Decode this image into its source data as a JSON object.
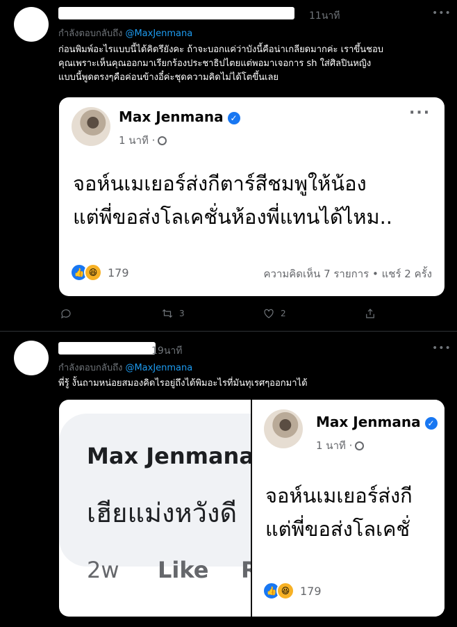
{
  "tweet1": {
    "time": "11นาที",
    "replying_prefix": "กำลังตอบกลับถึง",
    "replying_handle": "@MaxJenmana",
    "text_lines": [
      "ก่อนพิมพ์อะไรแบบนี้ได้คิดรึยังคะ ถ้าจะบอกแค่ว่าบังนี้คือน่าเกลียดมากค่ะ เราขึ้นชอบ",
      "คุณเพราะเห็นคุณออกมาเรียกร้องประชาธิปไตยแต่พอมาเจอการ sh ใส่ศิลปินหญิง",
      "แบบนี้พูดตรงๆคือค่อนข้างอี๋ค่ะชุดความคิดไม่ได้โตขึ้นเลย"
    ],
    "card": {
      "name": "Max Jenmana",
      "time": "1 นาที ·",
      "post_lines": [
        "จอห์นเมเยอร์ส่งกีตาร์สีชมพูให้น้อง",
        "แต่พี่ขอส่งโลเคชั่นห้องพี่แทนได้ไหม.."
      ],
      "reaction_count": "179",
      "stats": "ความคิดเห็น 7 รายการ • แชร์ 2 ครั้ง"
    },
    "actions": {
      "reply_count": "",
      "retweet_count": "3",
      "like_count": "2"
    }
  },
  "tweet2": {
    "time": "19นาที",
    "replying_prefix": "กำลังตอบกลับถึง",
    "replying_handle": "@MaxJenmana",
    "text": "พี่รู้ งั้นถามหน่อยสมองคิดไรอยู่ถึงได้พิมอะไรที่มันทุเรศๆออกมาได้",
    "left_panel": {
      "name": "Max Jenmana",
      "post": "เฮียแม่งหวังดี",
      "meta_time": "2w",
      "meta_like": "Like",
      "meta_reply": "R"
    },
    "right_panel": {
      "name": "Max Jenmana",
      "time": "1 นาที ·",
      "post_lines": [
        "จอห์นเมเยอร์ส่งกี",
        "แต่พี่ขอส่งโลเคชั่"
      ],
      "reaction_count": "179"
    }
  }
}
